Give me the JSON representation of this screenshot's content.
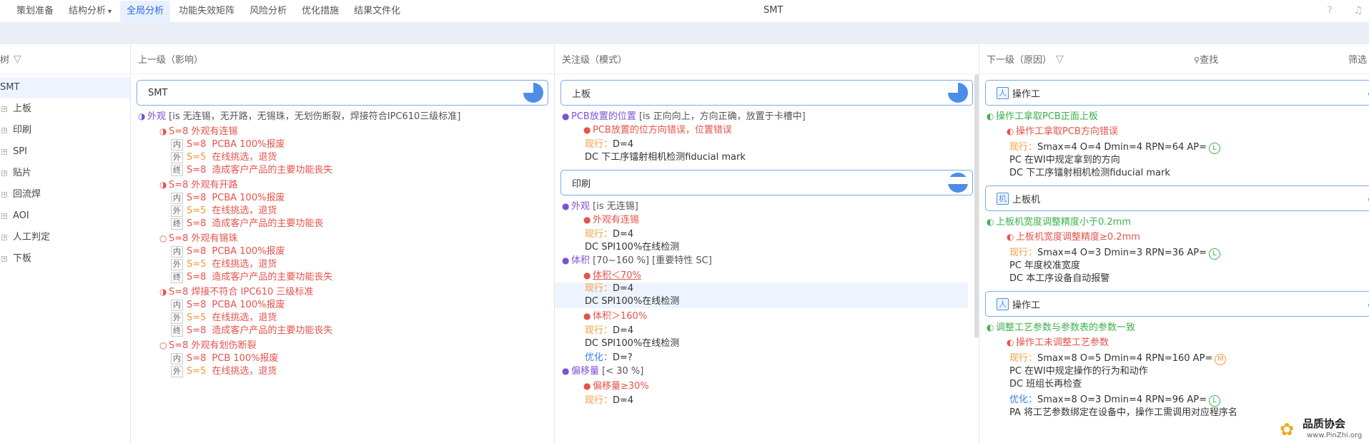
{
  "nav": {
    "tabs": [
      "策划准备",
      "结构分析",
      "全局分析",
      "功能失效矩阵",
      "风险分析",
      "优化措施",
      "结果文件化"
    ],
    "active_index": 2,
    "title": "SMT",
    "help_icon": "question-circle-icon",
    "bell_icon": "bell-icon"
  },
  "tree": {
    "header": "树",
    "items": [
      "SMT",
      "上板",
      "印刷",
      "SPI",
      "贴片",
      "回流焊",
      "AOI",
      "人工判定",
      "下板"
    ],
    "toggle": "⊞"
  },
  "upper": {
    "header": "上一级（影响）",
    "card": "SMT",
    "function": {
      "icon": "◑",
      "name": "外观",
      "spec": "[is 无连锡，无开路，无锡珠，无划伤断裂，焊接符合IPC610三级标准]"
    },
    "modes": [
      {
        "icon": "◑",
        "text": "S=8 外观有连锡",
        "effects": [
          {
            "tag": "内",
            "s": "S=8",
            "text": "PCBA 100%报废"
          },
          {
            "tag": "外",
            "s": "S=5",
            "text": "在线挑选，退货"
          },
          {
            "tag": "终",
            "s": "S=8",
            "text": "造成客户产品的主要功能丧失"
          }
        ]
      },
      {
        "icon": "◑",
        "text": "S=8 外观有开路",
        "effects": [
          {
            "tag": "内",
            "s": "S=8",
            "text": "PCBA 100%报废"
          },
          {
            "tag": "外",
            "s": "S=5",
            "text": "在线挑选，退货"
          },
          {
            "tag": "终",
            "s": "S=8",
            "text": "造成客户产品的主要功能丧"
          }
        ]
      },
      {
        "icon": "○",
        "text": "S=8 外观有锡珠",
        "effects": [
          {
            "tag": "内",
            "s": "S=8",
            "text": "PCBA 100%报废"
          },
          {
            "tag": "外",
            "s": "S=5",
            "text": "在线挑选，退货"
          },
          {
            "tag": "终",
            "s": "S=8",
            "text": "造成客户产品的主要功能丧失"
          }
        ]
      },
      {
        "icon": "◑",
        "text": "S=8 焊接不符合 IPC610 三级标准",
        "effects": [
          {
            "tag": "内",
            "s": "S=8",
            "text": "PCBA 100%报废"
          },
          {
            "tag": "外",
            "s": "S=5",
            "text": "在线挑选，退货"
          },
          {
            "tag": "终",
            "s": "S=8",
            "text": "造成客户产品的主要功能丧失"
          }
        ]
      },
      {
        "icon": "○",
        "text": "S=8 外观有划伤断裂",
        "effects": [
          {
            "tag": "内",
            "s": "S=8",
            "text": "PCB 100%报废"
          },
          {
            "tag": "外",
            "s": "S=5",
            "text": "在线挑选，退货"
          }
        ]
      }
    ]
  },
  "focus": {
    "header": "关注级（模式）",
    "card1": "上板",
    "f1": {
      "name": "PCB放置的位置",
      "spec": "[is 正向向上，方向正确，放置于卡槽中]"
    },
    "f1_mode": "PCB放置的位方向错误，位置错误",
    "f1_cur": "现行：",
    "f1_d": "D=4",
    "f1_dc": "DC  下工序镭射相机检测fiducial mark",
    "card2": "印刷",
    "f2": {
      "name": "外观",
      "spec": "[is 无连锡]"
    },
    "f2_mode": "外观有连锡",
    "f2_cur": "现行：",
    "f2_d": "D=4",
    "f2_dc": "DC  SPI100%在线检测",
    "f3": {
      "name": "体积",
      "spec": "[70~160 %] [重要特性 SC]"
    },
    "f3_mode1": "体积＜70%",
    "f3_cur1": "现行：",
    "f3_d1": "D=4",
    "f3_dc1": "DC  SPI100%在线检测",
    "f3_mode2": "体积＞160%",
    "f3_cur2": "现行：",
    "f3_d2": "D=4",
    "f3_dc2": "DC  SPI100%在线检测",
    "f3_opt": "优化：",
    "f3_optd": "D=?",
    "f4": {
      "name": "偏移量",
      "spec": "[< 30 %]"
    },
    "f4_mode": "偏移量≥30%",
    "f4_cur": "现行：",
    "f4_d": "D=4"
  },
  "lower": {
    "header": "下一级（原因）",
    "find": "查找",
    "filter": "筛选",
    "c1": {
      "badge": "人",
      "label": "操作工"
    },
    "c1_func": "操作工拿取PCB正面上板",
    "c1_mode": "操作工拿取PCB方向错误",
    "c1_cur": "现行：",
    "c1_vals": "Smax=4  O=4  Dmin=4  RPN=64  AP=",
    "c1_ap": "L",
    "c1_pc": "PC  在WI中规定拿到的方向",
    "c1_dc": "DC  下工序镭射相机检测fiducial mark",
    "c2": {
      "badge": "机",
      "label": "上板机"
    },
    "c2_func": "上板机宽度调整精度小于0.2mm",
    "c2_mode": "上板机宽度调整精度≥0.2mm",
    "c2_cur": "现行：",
    "c2_vals": "Smax=4  O=3  Dmin=3  RPN=36  AP=",
    "c2_ap": "L",
    "c2_pc": "PC  年度校准宽度",
    "c2_dc": "DC  本工序设备自动报警",
    "c3": {
      "badge": "人",
      "label": "操作工"
    },
    "c3_func": "调整工艺参数与参数表的参数一致",
    "c3_mode": "操作工未调整工艺参数",
    "c3_cur": "现行：",
    "c3_vals": "Smax=8  O=5  Dmin=4  RPN=160  AP=",
    "c3_ap": "M",
    "c3_pc": "PC  在WI中规定操作的行为和动作",
    "c3_dc": "DC  班组长再检查",
    "c3_opt": "优化：",
    "c3_optvals": "Smax=8  O=3  Dmin=4  RPN=96  AP=",
    "c3_optap": "L",
    "c3_pa": "PA  将工艺参数绑定在设备中，操作工需调用对应程序名"
  },
  "logo": {
    "text": "品质协会",
    "url": "www.PinZhi.org"
  }
}
